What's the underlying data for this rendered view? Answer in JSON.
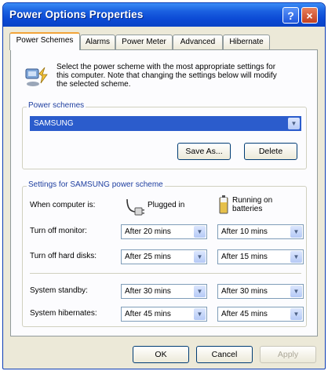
{
  "window": {
    "title": "Power Options Properties"
  },
  "titlebar_buttons": {
    "help": "?",
    "close": "×"
  },
  "tabs": [
    {
      "label": "Power Schemes"
    },
    {
      "label": "Alarms"
    },
    {
      "label": "Power Meter"
    },
    {
      "label": "Advanced"
    },
    {
      "label": "Hibernate"
    }
  ],
  "intro": {
    "line1": "Select the power scheme with the most appropriate settings for",
    "line2": "this computer. Note that changing the settings below will modify",
    "line3": "the selected scheme."
  },
  "power_schemes": {
    "label": "Power schemes",
    "selected": "SAMSUNG",
    "save_as_label": "Save As...",
    "delete_label": "Delete"
  },
  "settings": {
    "group_label": "Settings for SAMSUNG power scheme",
    "when_label": "When computer is:",
    "plugged_in": "Plugged in",
    "batteries_line1": "Running on",
    "batteries_line2": "batteries",
    "rows": [
      {
        "label": "Turn off monitor:",
        "plugged": "After 20 mins",
        "battery": "After 10 mins"
      },
      {
        "label": "Turn off hard disks:",
        "plugged": "After 25 mins",
        "battery": "After 15 mins"
      },
      {
        "label": "System standby:",
        "plugged": "After 30 mins",
        "battery": "After 30 mins"
      },
      {
        "label": "System hibernates:",
        "plugged": "After 45 mins",
        "battery": "After 45 mins"
      }
    ]
  },
  "dialog_buttons": {
    "ok": "OK",
    "cancel": "Cancel",
    "apply": "Apply"
  },
  "colors": {
    "title_bar": "#0b49d4",
    "active_tab_accent": "#f2a43a",
    "selection": "#2b5ccc"
  },
  "icons": [
    "power-options-icon",
    "plug-icon",
    "battery-icon",
    "help-icon",
    "close-icon",
    "chevron-down-icon"
  ]
}
